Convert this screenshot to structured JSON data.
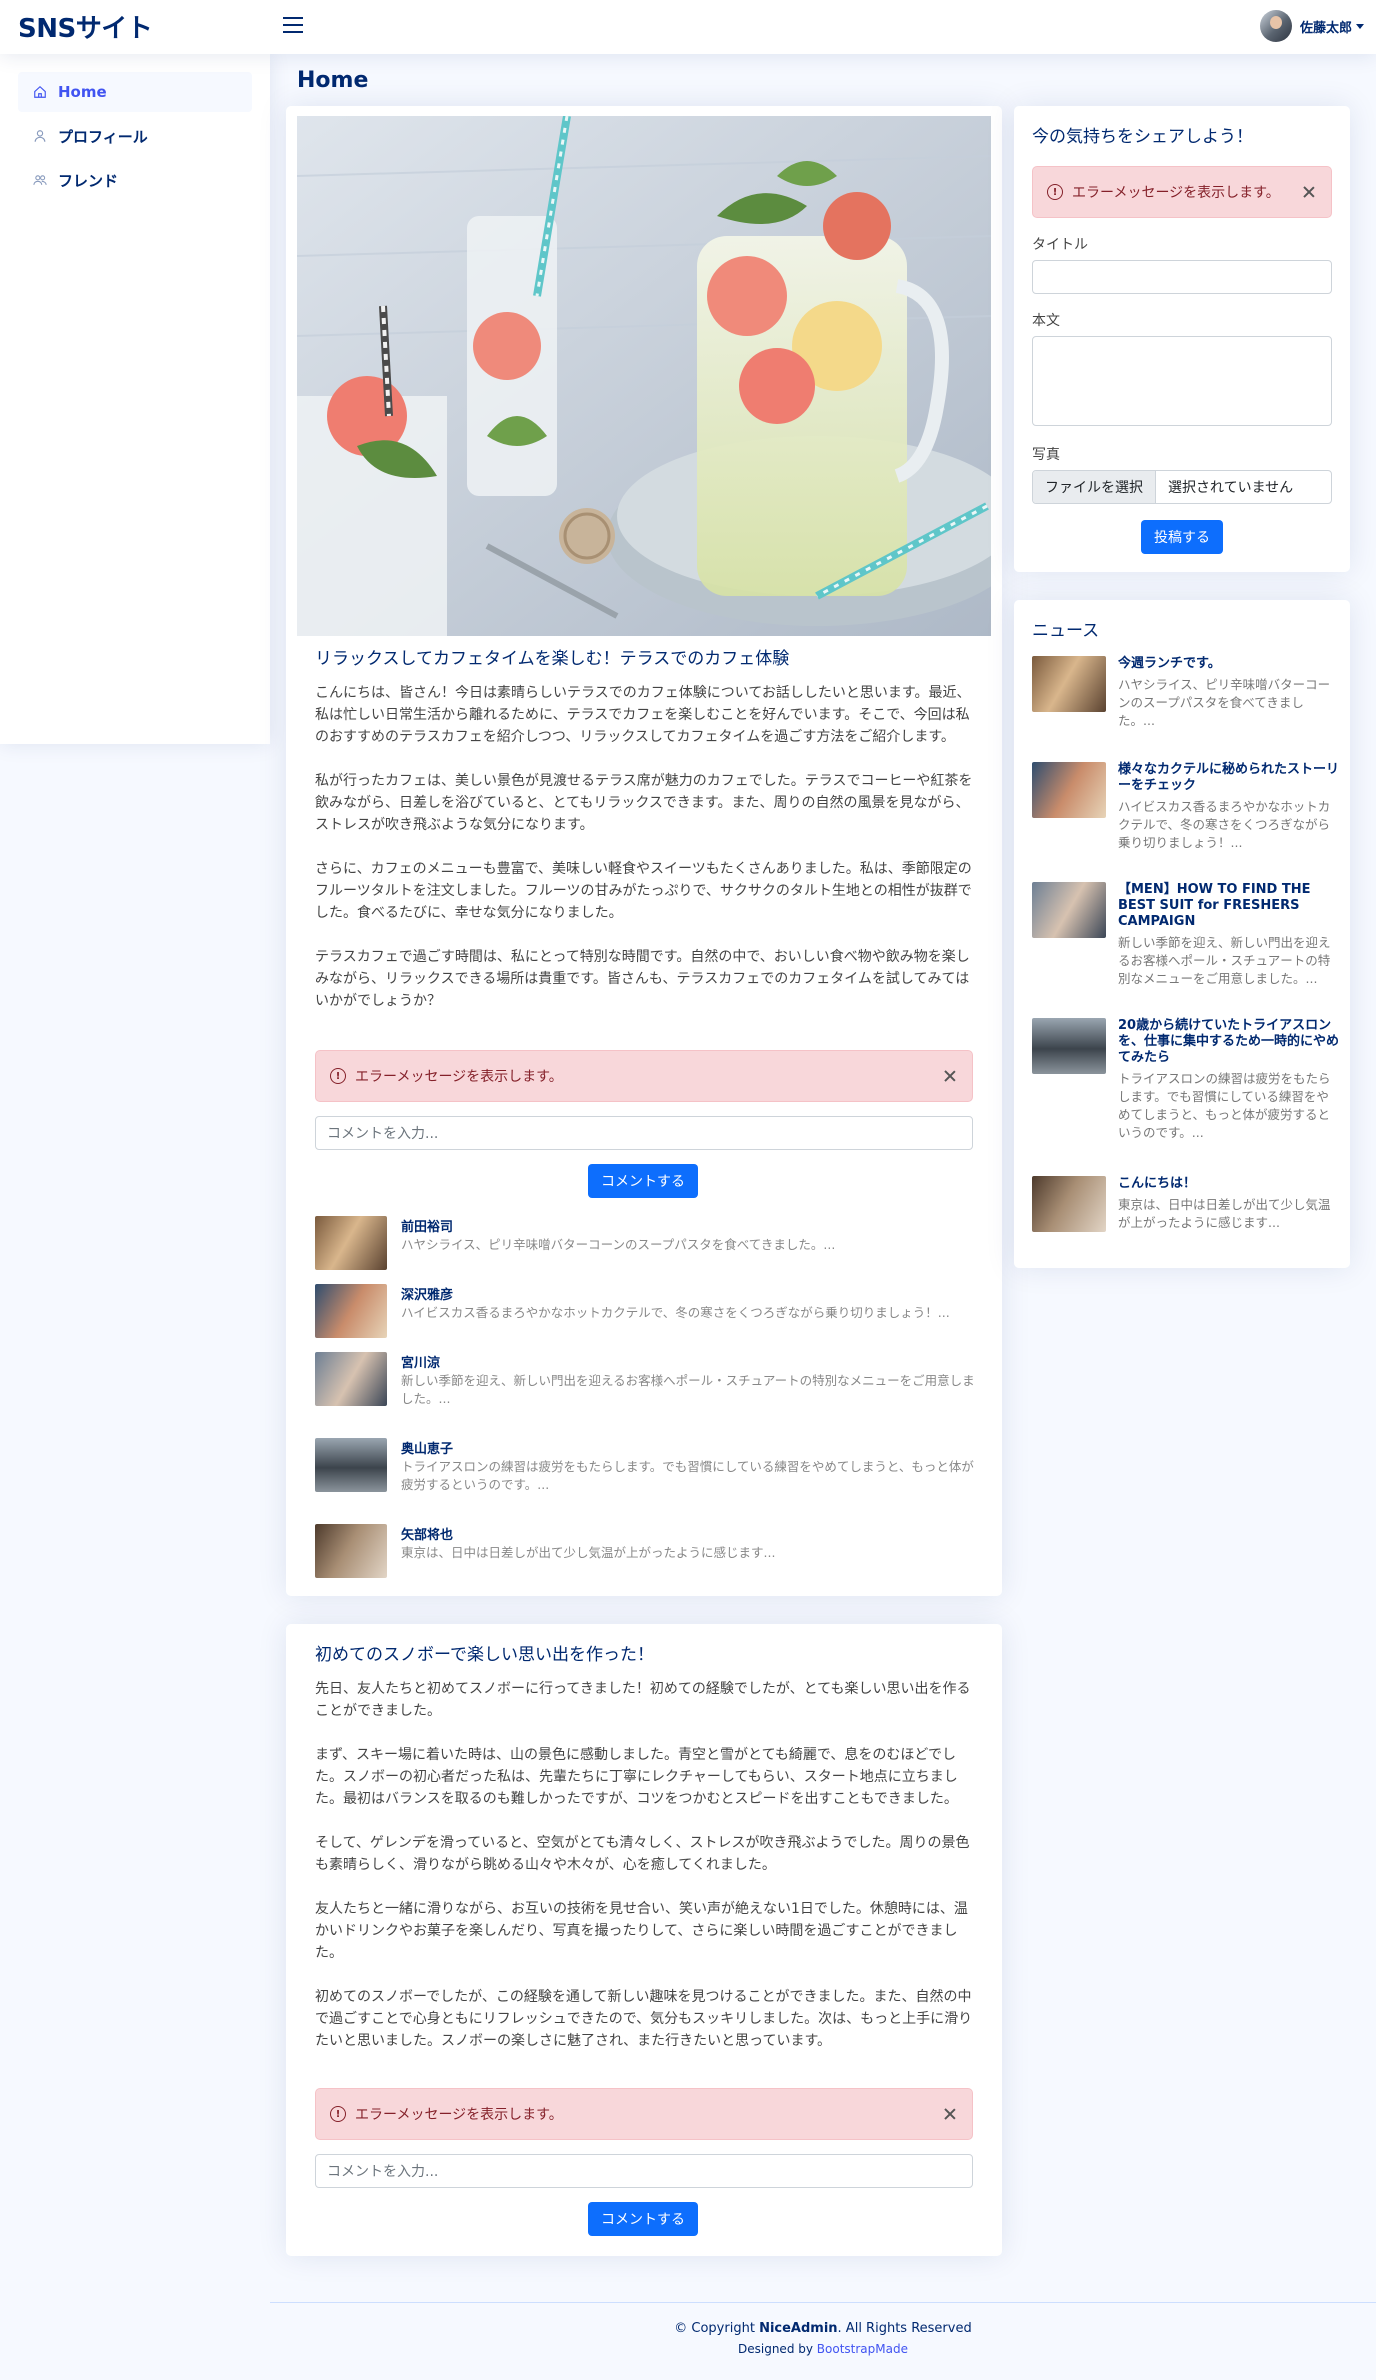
{
  "app": {
    "logo": "SNSサイト",
    "user_name": "佐藤太郎"
  },
  "sidebar": {
    "items": [
      {
        "label": "Home",
        "icon": "home-icon"
      },
      {
        "label": "プロフィール",
        "icon": "person-icon"
      },
      {
        "label": "フレンド",
        "icon": "people-icon"
      }
    ]
  },
  "page": {
    "title": "Home"
  },
  "posts": [
    {
      "title": "リラックスしてカフェタイムを楽しむ！テラスでのカフェ体験",
      "paragraphs": [
        "こんにちは、皆さん！今日は素晴らしいテラスでのカフェ体験についてお話ししたいと思います。最近、私は忙しい日常生活から離れるために、テラスでカフェを楽しむことを好んでいます。そこで、今回は私のおすすめのテラスカフェを紹介しつつ、リラックスしてカフェタイムを過ごす方法をご紹介します。",
        "私が行ったカフェは、美しい景色が見渡せるテラス席が魅力のカフェでした。テラスでコーヒーや紅茶を飲みながら、日差しを浴びていると、とてもリラックスできます。また、周りの自然の風景を見ながら、ストレスが吹き飛ぶような気分になります。",
        "さらに、カフェのメニューも豊富で、美味しい軽食やスイーツもたくさんありました。私は、季節限定のフルーツタルトを注文しました。フルーツの甘みがたっぷりで、サクサクのタルト生地との相性が抜群でした。食べるたびに、幸せな気分になりました。",
        "テラスカフェで過ごす時間は、私にとって特別な時間です。自然の中で、おいしい食べ物や飲み物を楽しみながら、リラックスできる場所は貴重です。皆さんも、テラスカフェでのカフェタイムを試してみてはいかがでしょうか？"
      ],
      "alert": "エラーメッセージを表示します。",
      "comment_placeholder": "コメントを入力...",
      "comment_button": "コメントする",
      "comments": [
        {
          "name": "前田裕司",
          "text": "ハヤシライス、ピリ辛味噌バターコーンのスープパスタを食べてきました。..."
        },
        {
          "name": "深沢雅彦",
          "text": "ハイビスカス香るまろやかなホットカクテルで、冬の寒さをくつろぎながら乗り切りましょう！..."
        },
        {
          "name": "宮川涼",
          "text": "新しい季節を迎え、新しい門出を迎えるお客様へポール・スチュアートの特別なメニューをご用意しました。..."
        },
        {
          "name": "奥山恵子",
          "text": "トライアスロンの練習は疲労をもたらします。でも習慣にしている練習をやめてしまうと、もっと体が疲労するというのです。..."
        },
        {
          "name": "矢部将也",
          "text": "東京は、日中は日差しが出て少し気温が上がったように感じます..."
        }
      ]
    },
    {
      "title": "初めてのスノボーで楽しい思い出を作った！",
      "paragraphs": [
        "先日、友人たちと初めてスノボーに行ってきました！初めての経験でしたが、とても楽しい思い出を作ることができました。",
        "まず、スキー場に着いた時は、山の景色に感動しました。青空と雪がとても綺麗で、息をのむほどでした。スノボーの初心者だった私は、先輩たちに丁寧にレクチャーしてもらい、スタート地点に立ちました。最初はバランスを取るのも難しかったですが、コツをつかむとスピードを出すこともできました。",
        "そして、ゲレンデを滑っていると、空気がとても清々しく、ストレスが吹き飛ぶようでした。周りの景色も素晴らしく、滑りながら眺める山々や木々が、心を癒してくれました。",
        "友人たちと一緒に滑りながら、お互いの技術を見せ合い、笑い声が絶えない1日でした。休憩時には、温かいドリンクやお菓子を楽しんだり、写真を撮ったりして、さらに楽しい時間を過ごすことができました。",
        "初めてのスノボーでしたが、この経験を通して新しい趣味を見つけることができました。また、自然の中で過ごすことで心身ともにリフレッシュできたので、気分もスッキリしました。次は、もっと上手に滑りたいと思いました。スノボーの楽しさに魅了され、また行きたいと思っています。"
      ],
      "alert": "エラーメッセージを表示します。",
      "comment_placeholder": "コメントを入力...",
      "comment_button": "コメントする"
    }
  ],
  "share": {
    "title": "今の気持ちをシェアしよう！",
    "alert": "エラーメッセージを表示します。",
    "title_label": "タイトル",
    "body_label": "本文",
    "photo_label": "写真",
    "file_button": "ファイルを選択",
    "file_status": "選択されていません",
    "submit": "投稿する"
  },
  "news": {
    "title": "ニュース",
    "items": [
      {
        "title": "今週ランチです。",
        "text": "ハヤシライス、ピリ辛味噌バターコーンのスープパスタを食べてきました。..."
      },
      {
        "title": "様々なカクテルに秘められたストーリーをチェック",
        "text": "ハイビスカス香るまろやかなホットカクテルで、冬の寒さをくつろぎながら乗り切りましょう！..."
      },
      {
        "title": "【MEN】HOW TO FIND THE BEST SUIT for FRESHERS CAMPAIGN",
        "text": "新しい季節を迎え、新しい門出を迎えるお客様へポール・スチュアートの特別なメニューをご用意しました。..."
      },
      {
        "title": "20歳から続けていたトライアスロンを、仕事に集中するため一時的にやめてみたら",
        "text": "トライアスロンの練習は疲労をもたらします。でも習慣にしている練習をやめてしまうと、もっと体が疲労するというのです。..."
      },
      {
        "title": "こんにちは！",
        "text": "東京は、日中は日差しが出て少し気温が上がったように感じます..."
      }
    ]
  },
  "footer": {
    "copyright_prefix": "© Copyright ",
    "brand": "NiceAdmin",
    "copyright_suffix": ". All Rights Reserved",
    "designed_by": "Designed by ",
    "designer": "BootstrapMade"
  }
}
